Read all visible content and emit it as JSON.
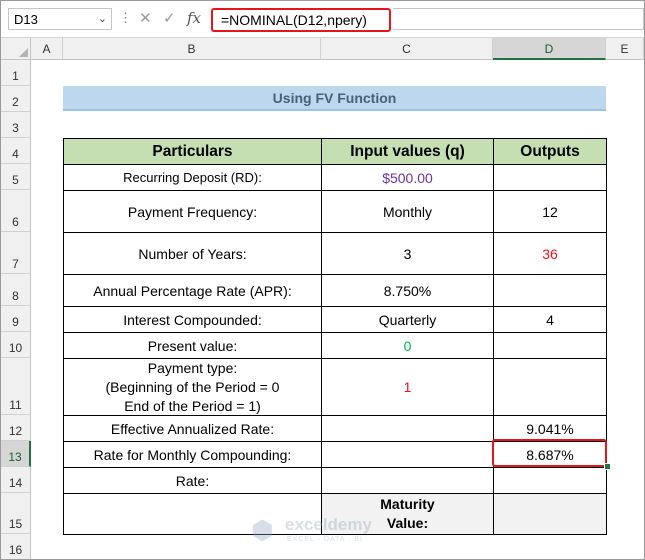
{
  "formula_bar": {
    "name_box": "D13",
    "formula": "=NOMINAL(D12,npery)",
    "cancel_icon": "✕",
    "enter_icon": "✓",
    "fx_label": "fx"
  },
  "columns": [
    "A",
    "B",
    "C",
    "D",
    "E"
  ],
  "selected_column": "D",
  "rows": [
    "1",
    "2",
    "3",
    "4",
    "5",
    "6",
    "7",
    "8",
    "9",
    "10",
    "11",
    "12",
    "13",
    "14",
    "15",
    "16"
  ],
  "selected_row": "13",
  "sheet": {
    "title": "Using FV Function",
    "headers": [
      "Particulars",
      "Input values (q)",
      "Outputs"
    ],
    "table": [
      {
        "label": "Recurring Deposit (RD):",
        "input": "$500.00",
        "output": ""
      },
      {
        "label": "Payment Frequency:",
        "input": "Monthly",
        "output": "12"
      },
      {
        "label": "Number of Years:",
        "input": "3",
        "output": "36"
      },
      {
        "label": "Annual Percentage Rate (APR):",
        "input": "8.750%",
        "output": ""
      },
      {
        "label": "Interest Compounded:",
        "input": "Quarterly",
        "output": "4"
      },
      {
        "label": "Present value:",
        "input": "0",
        "output": ""
      },
      {
        "label_lines": [
          "Payment type:",
          "(Beginning of the Period = 0",
          "End of the Period = 1)"
        ],
        "input": "1",
        "output": ""
      },
      {
        "label": "Effective Annualized Rate:",
        "input": "",
        "output": "9.041%"
      },
      {
        "label": "Rate for Monthly Compounding:",
        "input": "",
        "output": "8.687%"
      },
      {
        "label": "Rate:",
        "input": "",
        "output": ""
      },
      {
        "label": "",
        "input_lines": [
          "Maturity",
          "Value:"
        ],
        "output": ""
      }
    ],
    "colors": {
      "header_fill": "#c6dfb2",
      "title_fill": "#bdd7ee",
      "highlight_border": "#e8141c",
      "purple_text": "#7030a0",
      "red_text": "#e8141c",
      "green_text": "#00b050"
    }
  },
  "watermark": {
    "brand": "exceldemy",
    "tagline": "EXCEL · DATA · BI"
  }
}
